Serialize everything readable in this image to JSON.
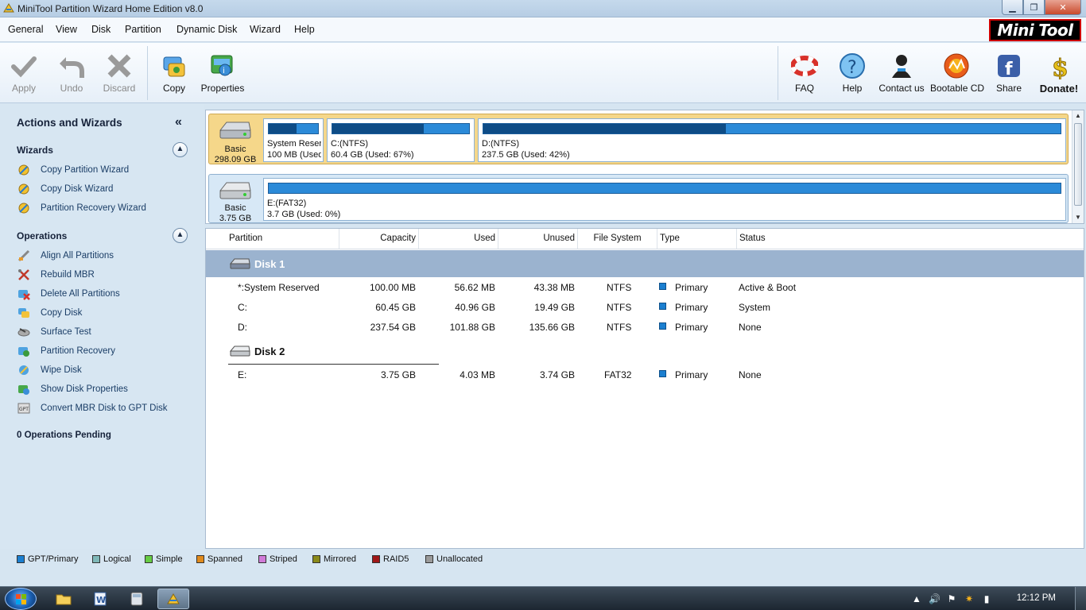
{
  "window": {
    "title": "MiniTool Partition Wizard Home Edition v8.0"
  },
  "menu": [
    "General",
    "View",
    "Disk",
    "Partition",
    "Dynamic Disk",
    "Wizard",
    "Help"
  ],
  "logo": {
    "text_a": "Mini",
    "text_b": "Tool"
  },
  "toolbar": {
    "apply": "Apply",
    "undo": "Undo",
    "discard": "Discard",
    "copy": "Copy",
    "properties": "Properties",
    "faq": "FAQ",
    "help": "Help",
    "contact": "Contact us",
    "bootable": "Bootable CD",
    "share": "Share",
    "donate": "Donate!"
  },
  "sidebar": {
    "title": "Actions and Wizards",
    "collapse_glyph": "«",
    "wizards_title": "Wizards",
    "wizards": [
      "Copy Partition Wizard",
      "Copy Disk Wizard",
      "Partition Recovery Wizard"
    ],
    "operations_title": "Operations",
    "operations": [
      "Align All Partitions",
      "Rebuild MBR",
      "Delete All Partitions",
      "Copy Disk",
      "Surface Test",
      "Partition Recovery",
      "Wipe Disk",
      "Show Disk Properties",
      "Convert MBR Disk to GPT Disk"
    ],
    "pending": "0 Operations Pending"
  },
  "diskmap": {
    "disk1": {
      "type": "Basic",
      "size": "298.09 GB",
      "partitions": [
        {
          "name": "System Reserv",
          "info": "100 MB (Used:",
          "used_fraction": 0.57
        },
        {
          "name": "C:(NTFS)",
          "info": "60.4 GB (Used: 67%)",
          "used_fraction": 0.67
        },
        {
          "name": "D:(NTFS)",
          "info": "237.5 GB (Used: 42%)",
          "used_fraction": 0.42
        }
      ]
    },
    "disk2": {
      "type": "Basic",
      "size": "3.75 GB",
      "partitions": [
        {
          "name": "E:(FAT32)",
          "info": "3.7 GB (Used: 0%)",
          "used_fraction": 0.0
        }
      ]
    }
  },
  "table": {
    "headers": [
      "Partition",
      "Capacity",
      "Used",
      "Unused",
      "File System",
      "Type",
      "Status"
    ],
    "disk1_label": "Disk 1",
    "disk2_label": "Disk 2",
    "disk1_rows": [
      {
        "partition": "*:System Reserved",
        "capacity": "100.00 MB",
        "used": "56.62 MB",
        "unused": "43.38 MB",
        "fs": "NTFS",
        "type": "Primary",
        "status": "Active & Boot"
      },
      {
        "partition": "C:",
        "capacity": "60.45 GB",
        "used": "40.96 GB",
        "unused": "19.49 GB",
        "fs": "NTFS",
        "type": "Primary",
        "status": "System"
      },
      {
        "partition": "D:",
        "capacity": "237.54 GB",
        "used": "101.88 GB",
        "unused": "135.66 GB",
        "fs": "NTFS",
        "type": "Primary",
        "status": "None"
      }
    ],
    "disk2_rows": [
      {
        "partition": "E:",
        "capacity": "3.75 GB",
        "used": "4.03 MB",
        "unused": "3.74 GB",
        "fs": "FAT32",
        "type": "Primary",
        "status": "None"
      }
    ]
  },
  "legend": [
    {
      "label": "GPT/Primary",
      "color": "#1b7fd0"
    },
    {
      "label": "Logical",
      "color": "#7fb8b8"
    },
    {
      "label": "Simple",
      "color": "#66cc44"
    },
    {
      "label": "Spanned",
      "color": "#e08a1c"
    },
    {
      "label": "Striped",
      "color": "#d07ad8"
    },
    {
      "label": "Mirrored",
      "color": "#8a8a1a"
    },
    {
      "label": "RAID5",
      "color": "#a01818"
    },
    {
      "label": "Unallocated",
      "color": "#9a9a9a"
    }
  ],
  "taskbar": {
    "clock": "12:12 PM"
  }
}
